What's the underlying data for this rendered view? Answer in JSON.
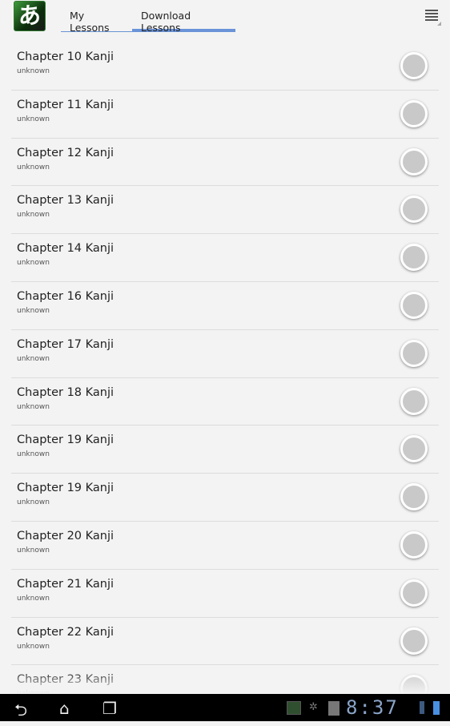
{
  "app": {
    "icon_glyph": "あ"
  },
  "tabs": [
    {
      "label": "My Lessons",
      "selected": false
    },
    {
      "label": "Download Lessons",
      "selected": true
    }
  ],
  "accent": "#6a93d8",
  "lessons": [
    {
      "title": "Chapter 10 Kanji",
      "subtitle": "unknown"
    },
    {
      "title": "Chapter 11 Kanji",
      "subtitle": "unknown"
    },
    {
      "title": "Chapter 12 Kanji",
      "subtitle": "unknown"
    },
    {
      "title": "Chapter 13 Kanji",
      "subtitle": "unknown"
    },
    {
      "title": "Chapter 14 Kanji",
      "subtitle": "unknown"
    },
    {
      "title": "Chapter 16 Kanji",
      "subtitle": "unknown"
    },
    {
      "title": "Chapter 17 Kanji",
      "subtitle": "unknown"
    },
    {
      "title": "Chapter 18 Kanji",
      "subtitle": "unknown"
    },
    {
      "title": "Chapter 19 Kanji",
      "subtitle": "unknown"
    },
    {
      "title": "Chapter 19 Kanji",
      "subtitle": "unknown"
    },
    {
      "title": "Chapter 20 Kanji",
      "subtitle": "unknown"
    },
    {
      "title": "Chapter 21 Kanji",
      "subtitle": "unknown"
    },
    {
      "title": "Chapter 22 Kanji",
      "subtitle": "unknown"
    },
    {
      "title": "Chapter 23 Kanji",
      "subtitle": "unknown"
    }
  ],
  "statusbar": {
    "time": "8:37",
    "icons": [
      "screenshot-icon",
      "debug-icon",
      "sd-card-icon",
      "signal-icon",
      "battery-icon"
    ]
  },
  "navbar": {
    "icons": [
      "back-icon",
      "home-icon",
      "recent-apps-icon"
    ]
  }
}
